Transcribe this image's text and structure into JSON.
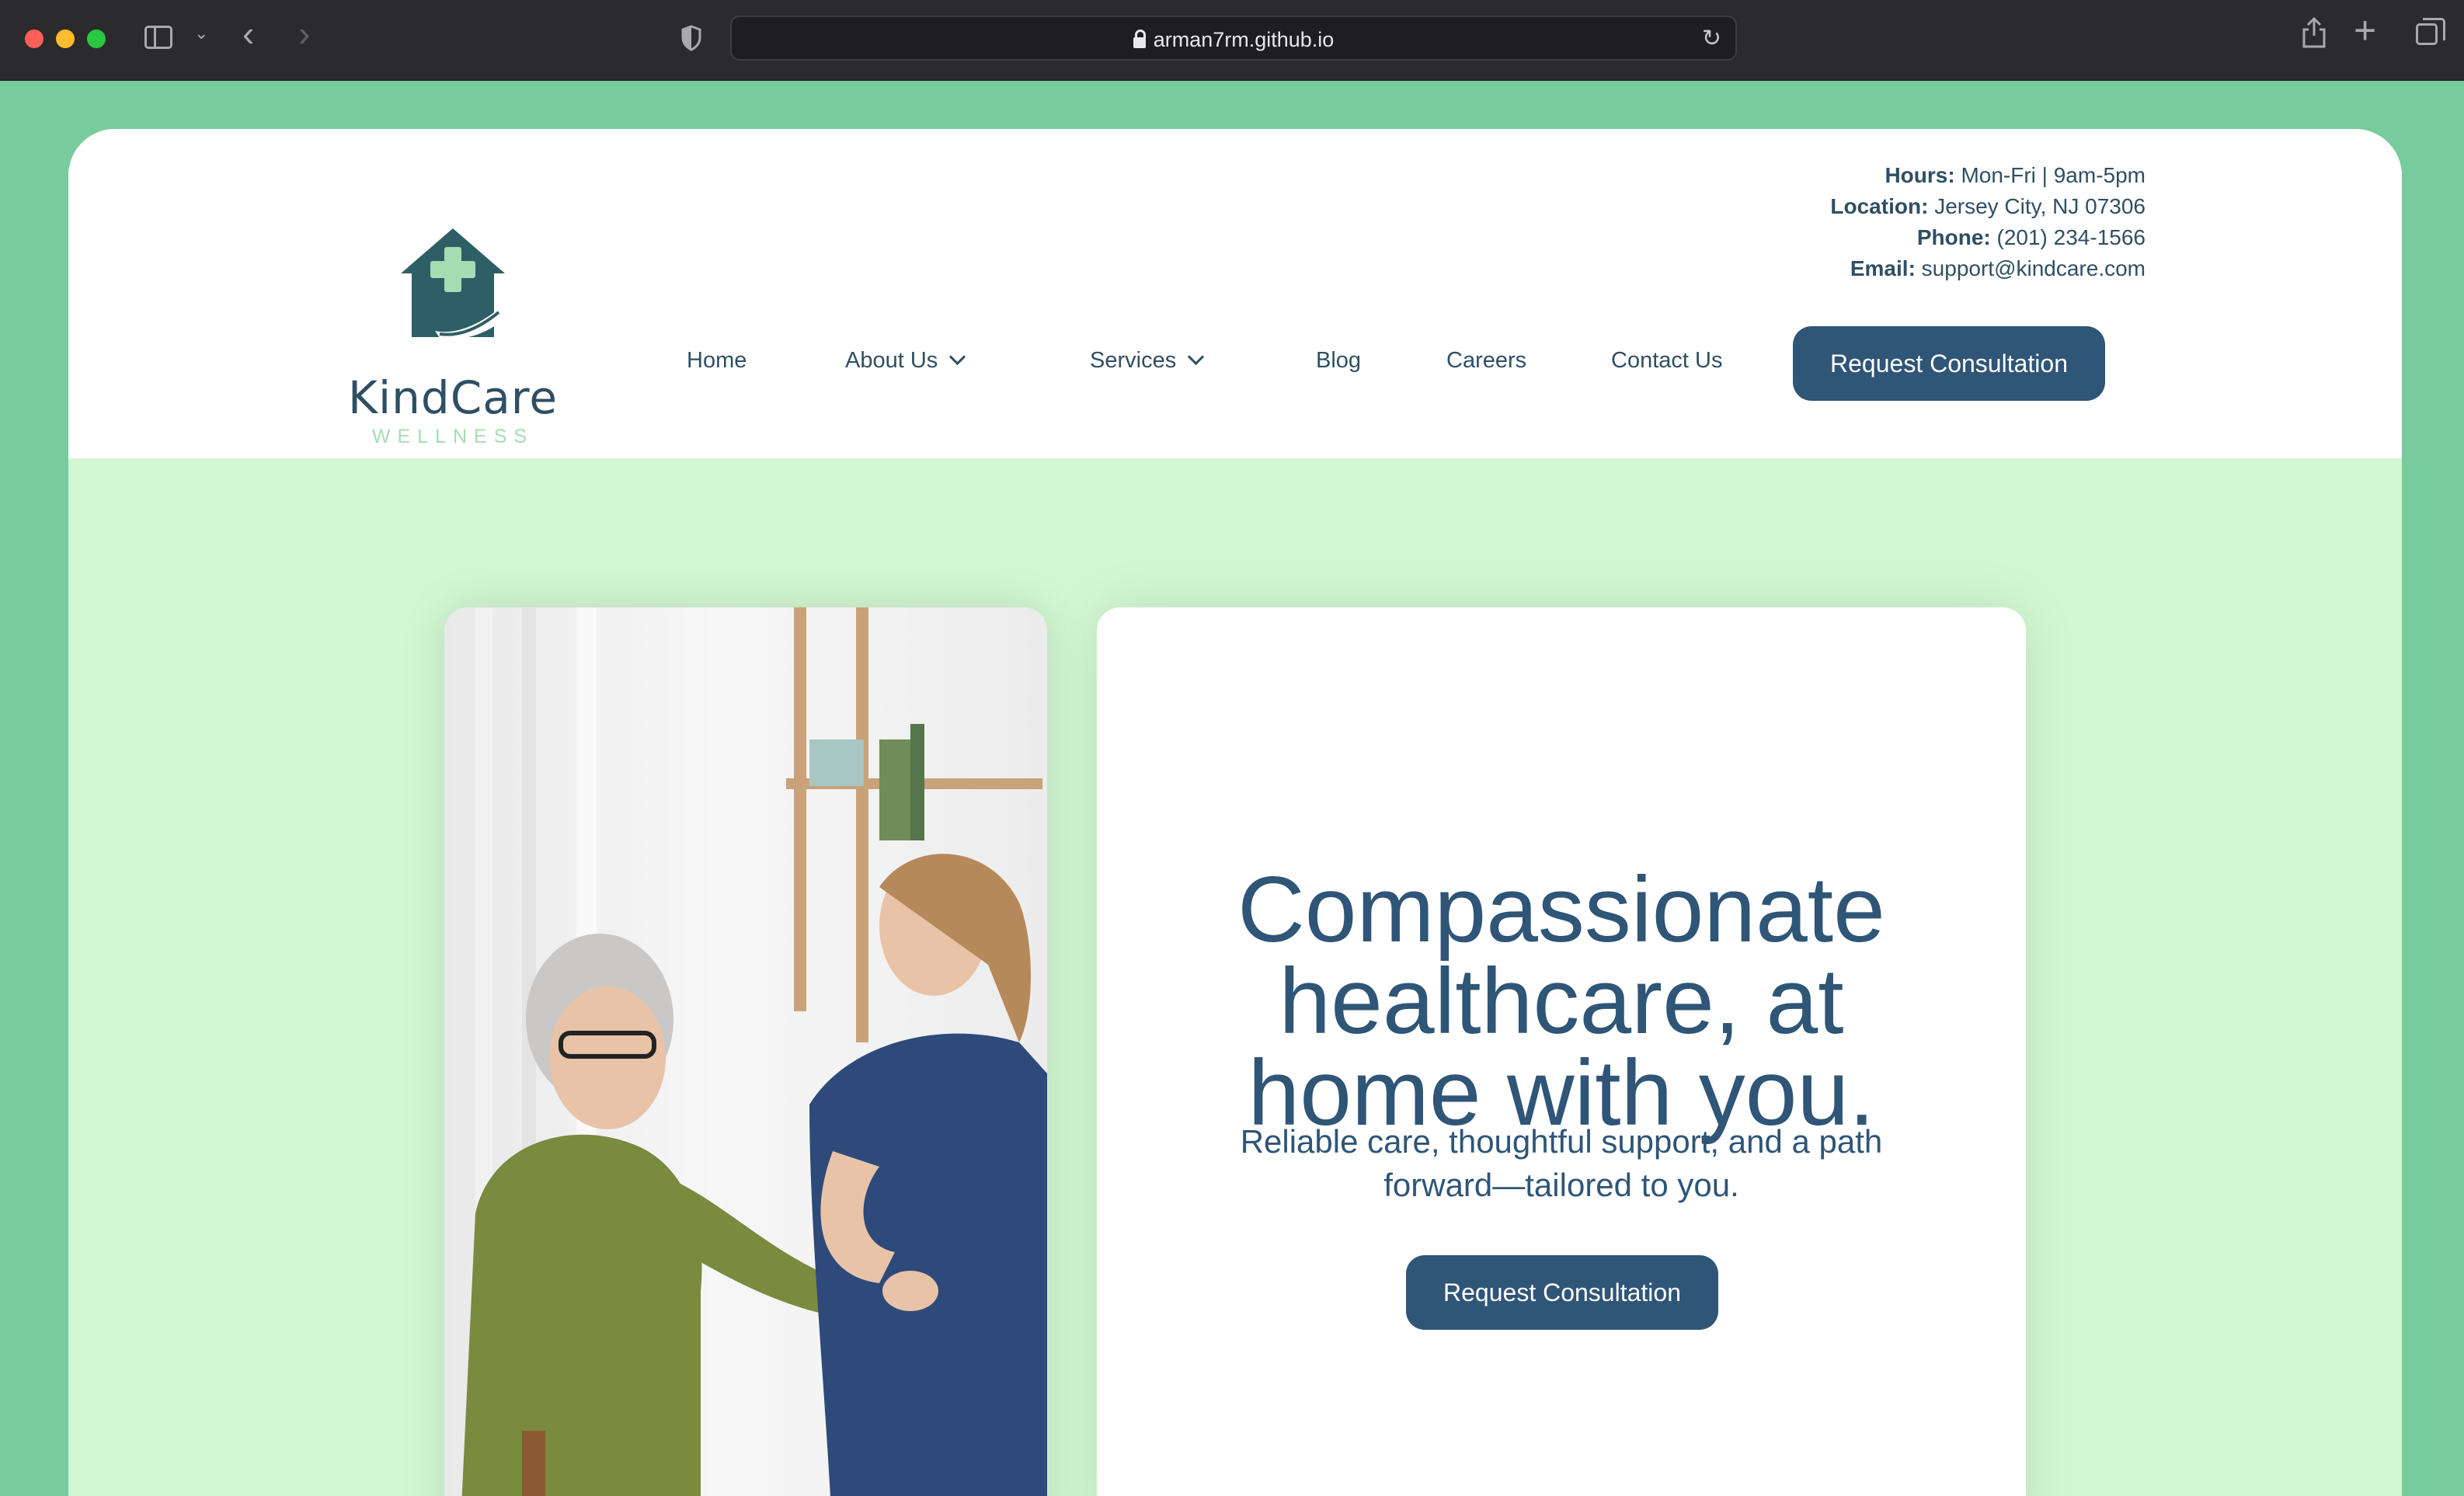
{
  "browser": {
    "url": "arman7rm.github.io"
  },
  "brand": {
    "name": "KindCare",
    "tagline": "WELLNESS",
    "primary_color": "#2f5577",
    "accent_green": "#77cb9c",
    "hero_bg": "#d3f7d2"
  },
  "contact": {
    "hours_label": "Hours:",
    "hours_value": "Mon-Fri | 9am-5pm",
    "location_label": "Location:",
    "location_value": "Jersey City, NJ 07306",
    "phone_label": "Phone:",
    "phone_value": "(201) 234-1566",
    "email_label": "Email:",
    "email_value": "support@kindcare.com"
  },
  "nav": {
    "home": "Home",
    "about": "About Us",
    "services": "Services",
    "blog": "Blog",
    "careers": "Careers",
    "contact": "Contact Us",
    "cta": "Request Consultation"
  },
  "hero": {
    "title_line1": "Compassionate",
    "title_line2": "healthcare, at",
    "title_line3": "home with you.",
    "subtitle": "Reliable care, thoughtful support, and a path forward—tailored to you.",
    "cta": "Request Consultation"
  }
}
